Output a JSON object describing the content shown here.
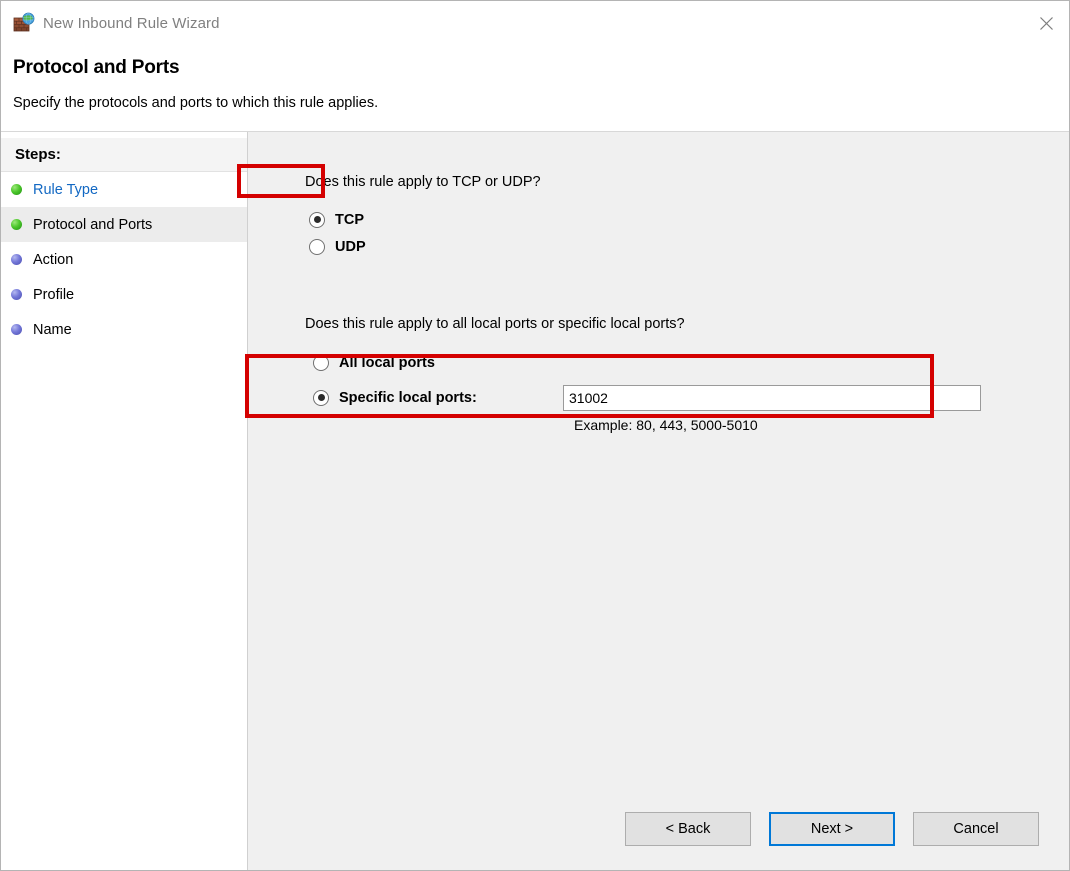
{
  "window": {
    "title": "New Inbound Rule Wizard",
    "icon": "firewall-globe-icon",
    "close_label": "✕"
  },
  "header": {
    "title": "Protocol and Ports",
    "subtitle": "Specify the protocols and ports to which this rule applies."
  },
  "sidebar": {
    "heading": "Steps:",
    "items": [
      {
        "label": "Rule Type",
        "state": "done",
        "style": "link"
      },
      {
        "label": "Protocol and Ports",
        "state": "done",
        "style": "current"
      },
      {
        "label": "Action",
        "state": "todo",
        "style": "normal"
      },
      {
        "label": "Profile",
        "state": "todo",
        "style": "normal"
      },
      {
        "label": "Name",
        "state": "todo",
        "style": "normal"
      }
    ]
  },
  "main": {
    "protocol_question": "Does this rule apply to TCP or UDP?",
    "protocol_options": [
      {
        "label": "TCP",
        "checked": true
      },
      {
        "label": "UDP",
        "checked": false
      }
    ],
    "ports_question": "Does this rule apply to all local ports or specific local ports?",
    "ports_options": [
      {
        "label": "All local ports",
        "checked": false
      },
      {
        "label": "Specific local ports:",
        "checked": true
      }
    ],
    "port_value": "31002",
    "port_placeholder": "",
    "example_text": "Example: 80, 443, 5000-5010"
  },
  "footer": {
    "back_label": "< Back",
    "next_label": "Next >",
    "cancel_label": "Cancel"
  },
  "colors": {
    "annotation": "#d40000",
    "focus": "#0078d7",
    "link": "#1268c3",
    "panel_bg": "#f0f0f0",
    "step_done": "#4cc72b",
    "step_todo": "#7478d8"
  }
}
